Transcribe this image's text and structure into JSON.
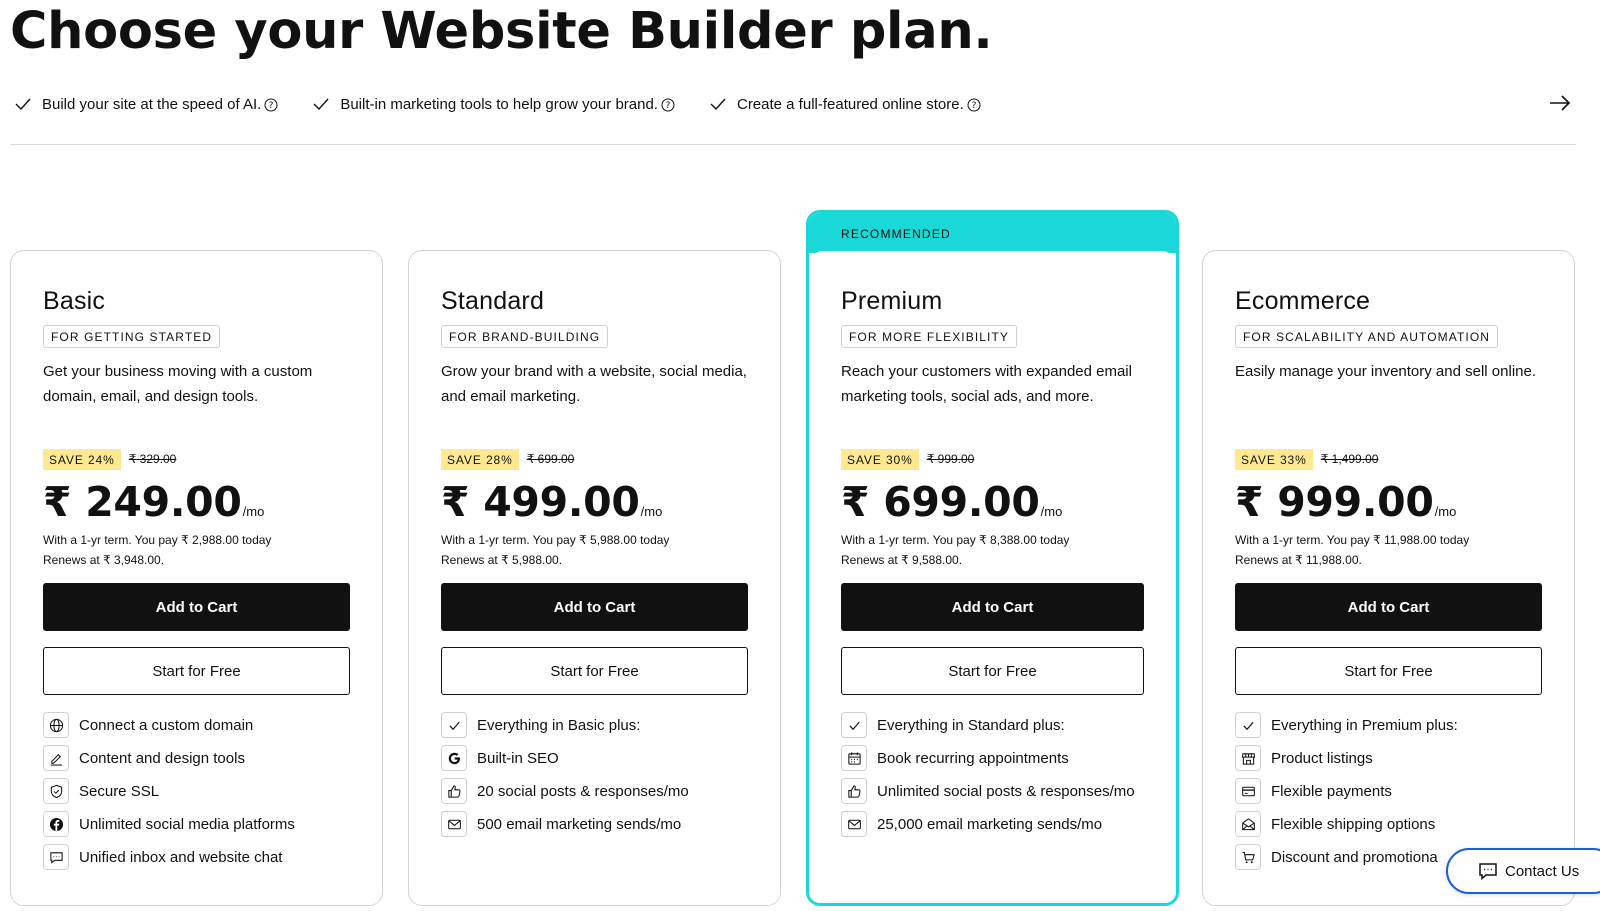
{
  "page": {
    "title": "Choose your Website Builder plan."
  },
  "benefits": [
    {
      "label": "Build your site at the speed of AI."
    },
    {
      "label": "Built-in marketing tools to help grow your brand."
    },
    {
      "label": "Create a full-featured online store."
    }
  ],
  "plans": [
    {
      "name": "Basic",
      "tagline": "FOR GETTING STARTED",
      "description": "Get your business moving with a custom domain, email, and design tools.",
      "save": "SAVE 24%",
      "old_price": "₹ 329.00",
      "price": "₹ 249.00",
      "per": "/mo",
      "term_line1": "With a 1-yr term. You pay ₹ 2,988.00 today",
      "term_line2": "Renews at ₹ 3,948.00.",
      "cart_label": "Add to Cart",
      "free_label": "Start for Free",
      "features": [
        {
          "icon": "globe-icon",
          "label": "Connect a custom domain"
        },
        {
          "icon": "pen-icon",
          "label": "Content and design tools"
        },
        {
          "icon": "shield-icon",
          "label": "Secure SSL"
        },
        {
          "icon": "facebook-icon",
          "label": "Unlimited social media platforms"
        },
        {
          "icon": "chat-icon",
          "label": "Unified inbox and website chat"
        }
      ]
    },
    {
      "name": "Standard",
      "tagline": "FOR BRAND-BUILDING",
      "description": "Grow your brand with a website, social media, and email marketing.",
      "save": "SAVE 28%",
      "old_price": "₹ 699.00",
      "price": "₹ 499.00",
      "per": "/mo",
      "term_line1": "With a 1-yr term. You pay ₹ 5,988.00 today",
      "term_line2": "Renews at ₹ 5,988.00.",
      "cart_label": "Add to Cart",
      "free_label": "Start for Free",
      "features": [
        {
          "icon": "check-icon",
          "label": "Everything in Basic plus:"
        },
        {
          "icon": "google-icon",
          "label": "Built-in SEO"
        },
        {
          "icon": "thumbs-up-icon",
          "label": "20 social posts & responses/mo"
        },
        {
          "icon": "mail-icon",
          "label": "500 email marketing sends/mo"
        }
      ]
    },
    {
      "name": "Premium",
      "ribbon": "RECOMMENDED",
      "tagline": "FOR MORE FLEXIBILITY",
      "description": "Reach your customers with expanded email marketing tools, social ads, and more.",
      "save": "SAVE 30%",
      "old_price": "₹ 999.00",
      "price": "₹ 699.00",
      "per": "/mo",
      "term_line1": "With a 1-yr term. You pay ₹ 8,388.00 today",
      "term_line2": "Renews at ₹ 9,588.00.",
      "cart_label": "Add to Cart",
      "free_label": "Start for Free",
      "features": [
        {
          "icon": "check-icon",
          "label": "Everything in Standard plus:"
        },
        {
          "icon": "calendar-icon",
          "label": "Book recurring appointments"
        },
        {
          "icon": "thumbs-up-icon",
          "label": "Unlimited social posts & responses/mo"
        },
        {
          "icon": "mail-icon",
          "label": "25,000 email marketing sends/mo"
        }
      ]
    },
    {
      "name": "Ecommerce",
      "tagline": "FOR SCALABILITY AND AUTOMATION",
      "description": "Easily manage your inventory and sell online.",
      "save": "SAVE 33%",
      "old_price": "₹ 1,499.00",
      "price": "₹ 999.00",
      "per": "/mo",
      "term_line1": "With a 1-yr term. You pay ₹ 11,988.00 today",
      "term_line2": "Renews at ₹ 11,988.00.",
      "cart_label": "Add to Cart",
      "free_label": "Start for Free",
      "features": [
        {
          "icon": "check-icon",
          "label": "Everything in Premium plus:"
        },
        {
          "icon": "store-icon",
          "label": "Product listings"
        },
        {
          "icon": "card-icon",
          "label": "Flexible payments"
        },
        {
          "icon": "envelope-open-icon",
          "label": "Flexible shipping options"
        },
        {
          "icon": "cart-icon",
          "label": "Discount and promotiona"
        }
      ]
    }
  ],
  "contact": {
    "label": "Contact Us"
  },
  "colors": {
    "accent": "#1bd8d8",
    "save_badge": "#ffe990",
    "button_dark": "#111111",
    "contact_border": "#1a5fd6"
  }
}
